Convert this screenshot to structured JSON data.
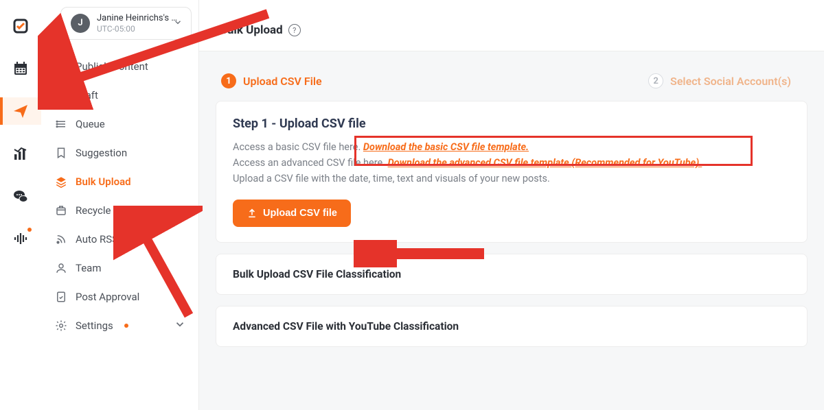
{
  "account": {
    "initial": "J",
    "name": "Janine Heinrichs's …",
    "tz": "UTC-05:00"
  },
  "sidebar": {
    "items": [
      {
        "label": "Publish Content"
      },
      {
        "label": "Draft"
      },
      {
        "label": "Queue"
      },
      {
        "label": "Suggestion"
      },
      {
        "label": "Bulk Upload"
      },
      {
        "label": "Recycle"
      },
      {
        "label": "Auto RSS"
      },
      {
        "label": "Team"
      },
      {
        "label": "Post Approval"
      },
      {
        "label": "Settings"
      }
    ]
  },
  "header": {
    "title": "Bulk Upload"
  },
  "steps": {
    "one_num": "1",
    "one_label": "Upload CSV File",
    "two_num": "2",
    "two_label": "Select Social Account(s)"
  },
  "step1": {
    "heading": "Step 1 - Upload CSV file",
    "line1_a": "Access a basic CSV file here. ",
    "line1_link": "Download the basic CSV file template.",
    "line2_a": "Access an advanced CSV file here. ",
    "line2_link": "Download the advanced CSV file template (Recommended for YouTube).",
    "line3": "Upload a CSV file with the date, time, text and visuals of your new posts.",
    "button": "Upload CSV file"
  },
  "accordion1": "Bulk Upload CSV File Classification",
  "accordion2": "Advanced CSV File with YouTube Classification"
}
